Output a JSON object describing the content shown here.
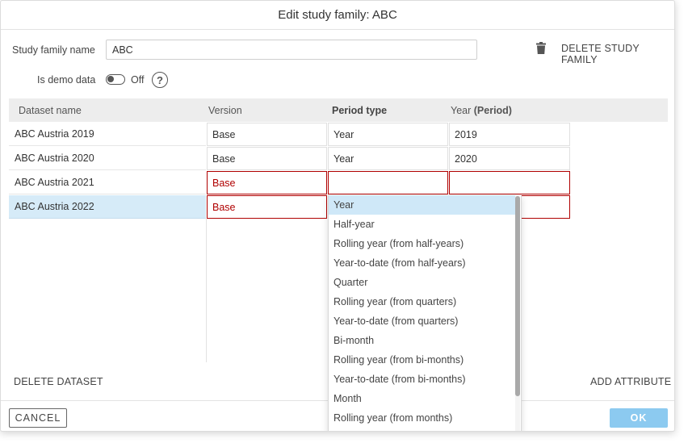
{
  "dialog": {
    "title": "Edit study family: ABC"
  },
  "form": {
    "name_label": "Study family name",
    "name_value": "ABC",
    "demo_label": "Is demo data",
    "demo_state": "Off",
    "help_glyph": "?",
    "delete_family_label": "DELETE STUDY FAMILY"
  },
  "table": {
    "headers": {
      "dataset": "Dataset name",
      "version": "Version",
      "period_type": "Period type",
      "year_prefix": "Year",
      "year_suffix": "(Period)"
    },
    "rows": [
      {
        "name": "ABC Austria 2019",
        "version": "Base",
        "period_type": "Year",
        "year": "2019"
      },
      {
        "name": "ABC Austria 2020",
        "version": "Base",
        "period_type": "Year",
        "year": "2020"
      },
      {
        "name": "ABC Austria 2021",
        "version": "Base",
        "period_type": "",
        "year": ""
      },
      {
        "name": "ABC Austria 2022",
        "version": "Base",
        "period_type": "",
        "year": ""
      }
    ]
  },
  "dropdown": {
    "options": [
      "Year",
      "Half-year",
      "Rolling year (from half-years)",
      "Year-to-date (from half-years)",
      "Quarter",
      "Rolling year (from quarters)",
      "Year-to-date (from quarters)",
      "Bi-month",
      "Rolling year (from bi-months)",
      "Year-to-date (from bi-months)",
      "Month",
      "Rolling year (from months)"
    ],
    "selected": "Year"
  },
  "actions": {
    "delete_dataset": "DELETE DATASET",
    "add_attribute": "ADD ATTRIBUTE",
    "cancel": "CANCEL",
    "ok": "OK"
  },
  "colors": {
    "error": "#b00000",
    "selected_row": "#d6ebf8",
    "ok_button": "#8ccaf0"
  }
}
